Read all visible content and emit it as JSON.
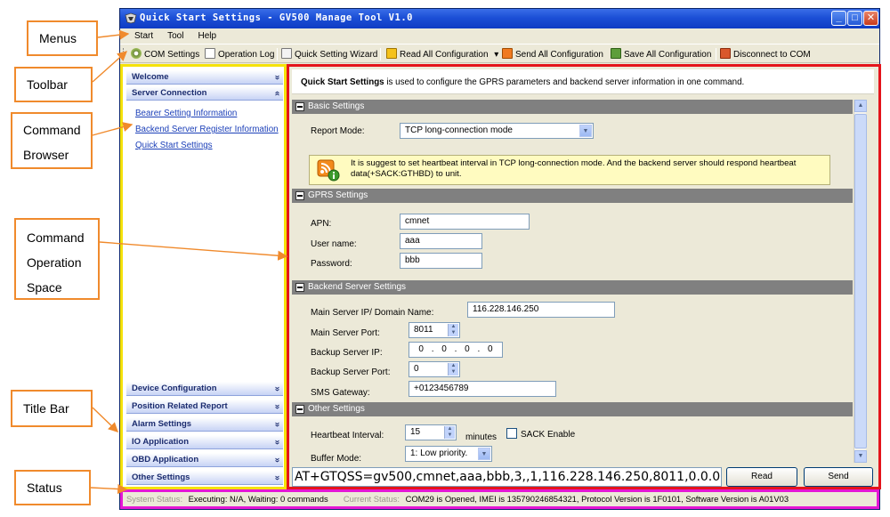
{
  "window": {
    "title": "Quick Start Settings - GV500 Manage Tool V1.0",
    "buttons": [
      "_",
      "□",
      "✕"
    ]
  },
  "menus": [
    "Start",
    "Tool",
    "Help"
  ],
  "toolbar": [
    {
      "label": "COM Settings",
      "icon": "gear-icon"
    },
    {
      "label": "Operation Log",
      "icon": "log-icon"
    },
    {
      "label": "Quick Setting Wizard",
      "icon": "wizard-icon"
    },
    {
      "label": "Read All Configuration",
      "icon": "read-icon",
      "dropdown": "▾"
    },
    {
      "label": "Send All Configuration",
      "icon": "send-icon"
    },
    {
      "label": "Save All Configuration",
      "icon": "save-icon"
    },
    {
      "label": "Disconnect to COM",
      "icon": "disconnect-icon"
    }
  ],
  "callouts": {
    "menus": "Menus",
    "toolbar": "Toolbar",
    "command_browser": [
      "Command",
      "Browser"
    ],
    "command_space": [
      "Command",
      "Operation",
      "Space"
    ],
    "title_bar": "Title Bar",
    "status": "Status"
  },
  "browser": {
    "top_sections": [
      {
        "label": "Welcome",
        "chevron": "»"
      },
      {
        "label": "Server Connection",
        "chevron": "«"
      }
    ],
    "links": [
      "Bearer Setting Information",
      "Backend Server Register Information",
      "Quick Start Settings"
    ],
    "bottom_sections": [
      {
        "label": "Device Configuration",
        "chevron": "»"
      },
      {
        "label": "Position Related Report",
        "chevron": "»"
      },
      {
        "label": "Alarm Settings",
        "chevron": "»"
      },
      {
        "label": "IO Application",
        "chevron": "»"
      },
      {
        "label": "OBD Application",
        "chevron": "»"
      },
      {
        "label": "Other Settings",
        "chevron": "»"
      }
    ]
  },
  "main": {
    "description_bold": "Quick Start Settings",
    "description_rest": " is used to configure the GPRS parameters and backend server information in one command.",
    "basic": {
      "header": "Basic Settings",
      "report_mode_label": "Report Mode:",
      "report_mode_value": "TCP long-connection mode",
      "note": "It is suggest to set heartbeat interval in TCP long-connection mode. And the backend server should respond heartbeat data(+SACK:GTHBD) to unit."
    },
    "gprs": {
      "header": "GPRS Settings",
      "apn_label": "APN:",
      "apn_value": "cmnet",
      "user_label": "User name:",
      "user_value": "aaa",
      "pass_label": "Password:",
      "pass_value": "bbb"
    },
    "backend": {
      "header": "Backend Server Settings",
      "main_ip_label": "Main Server IP/ Domain Name:",
      "main_ip_value": "116.228.146.250",
      "main_port_label": "Main Server Port:",
      "main_port_value": "8011",
      "backup_ip_label": "Backup Server IP:",
      "backup_ip_value": "0 . 0 . 0 . 0",
      "backup_port_label": "Backup Server Port:",
      "backup_port_value": "0",
      "sms_label": "SMS Gateway:",
      "sms_value": "+0123456789"
    },
    "other": {
      "header": "Other Settings",
      "heartbeat_label": "Heartbeat Interval:",
      "heartbeat_value": "15",
      "heartbeat_unit": "minutes",
      "sack_label": "SACK Enable",
      "buffer_label": "Buffer Mode:",
      "buffer_value": "1: Low priority."
    },
    "command": "AT+GTQSS=gv500,cmnet,aaa,bbb,3,,1,116.228.146.250,8011,0.0.0.0",
    "read_label": "Read",
    "send_label": "Send"
  },
  "status": {
    "system_label": "System Status:",
    "system_value": "Executing: N/A, Waiting: 0 commands",
    "current_label": "Current Status:",
    "current_value": "COM29 is Opened, IMEI is 135790246854321, Protocol Version is 1F0101, Software Version is A01V03"
  }
}
